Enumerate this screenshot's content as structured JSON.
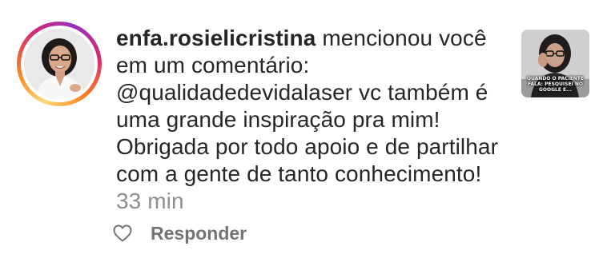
{
  "notification": {
    "username": "enfa.rosielicristina",
    "action_text": " mencionou você em um comentário: ",
    "comment": "@qualidadedevidalaser vc também é uma grande inspiração pra mim! Obrigada por todo apoio e de partilhar com a gente de tanto conhecimento!",
    "time": "33 min",
    "thumbnail_caption": "QUANDO O PACIENTE FALA: PESQUISEI NO GOOGLE E..."
  },
  "actions": {
    "like_icon": "heart-outline-icon",
    "reply_label": "Responder"
  },
  "colors": {
    "text": "#262626",
    "muted": "#8e8e8e",
    "reply": "#737373",
    "story_ring": [
      "#feda75",
      "#fa7e1e",
      "#d62976",
      "#962fbf"
    ]
  }
}
